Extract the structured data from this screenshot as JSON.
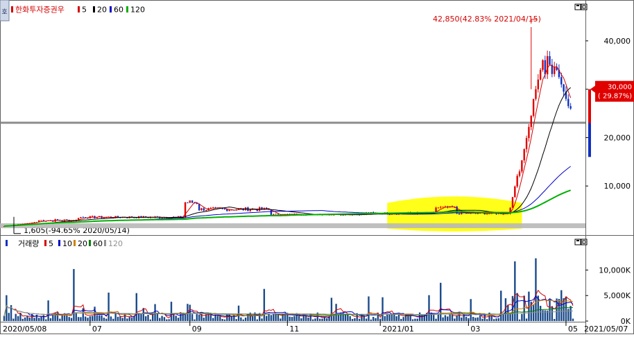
{
  "panel": {
    "side_tab": "호",
    "legend": [
      {
        "text": "한화투자증권우",
        "color": "#d40000"
      },
      {
        "text": "5",
        "color": "#d40000"
      },
      {
        "text": "20",
        "color": "#000000"
      },
      {
        "text": "60",
        "color": "#0000c8"
      },
      {
        "text": "120",
        "color": "#00b000"
      }
    ],
    "annotation_high": "42,850(42.83% 2021/04/15)",
    "annotation_low": "1,605(-94.65% 2020/05/14)",
    "price_box": {
      "line1": "30,000",
      "line2": "( 29.87%)"
    }
  },
  "volume_panel": {
    "legend": [
      {
        "text": "거래량",
        "color": "#000000"
      },
      {
        "text": "5",
        "color": "#d40000"
      },
      {
        "text": "10",
        "color": "#0000c8"
      },
      {
        "text": "20",
        "color": "#d08000"
      },
      {
        "text": "60",
        "color": "#008000"
      },
      {
        "text": "120",
        "color": "#909090"
      }
    ]
  },
  "colors": {
    "up": "#e00000",
    "down": "#1030c0",
    "highlight": "#ffff00",
    "hline": "#808080",
    "box": "#e00000"
  },
  "chart_data": [
    {
      "type": "candlestick",
      "y_axis": {
        "min": 0,
        "max": 45000,
        "ticks": [
          10000,
          20000,
          30000,
          40000
        ],
        "tick_labels": [
          "10,000",
          "20,000",
          "30,000",
          "40,000"
        ]
      },
      "x_axis": {
        "start_label": "2020/05/08",
        "end_label": "2021/05/07",
        "ticks": [
          {
            "label": "07",
            "x_index": 37
          },
          {
            "label": "09",
            "x_index": 80
          },
          {
            "label": "11",
            "x_index": 122
          },
          {
            "label": "2021/01",
            "x_index": 162
          },
          {
            "label": "03",
            "x_index": 200
          },
          {
            "label": "05",
            "x_index": 242
          }
        ]
      },
      "highlights": {
        "horizontal_levels": [
          23000,
          2000
        ],
        "circled_range": [
          165,
          223
        ]
      },
      "annotations": [
        {
          "text": "42,850(42.83% 2021/04/15)",
          "value": 42850
        },
        {
          "text": "1,605(-94.65% 2020/05/14)",
          "value": 1605
        }
      ],
      "last_close": 30000,
      "last_change_pct": 29.87,
      "ma_periods": [
        5,
        20,
        60,
        120
      ]
    },
    {
      "type": "bar",
      "title": "거래량",
      "y_axis": {
        "min": 0,
        "max": 14000,
        "ticks": [
          0,
          5000,
          10000
        ],
        "tick_labels": [
          "0K",
          "5,000K",
          "10,000K"
        ]
      },
      "series_names": [
        "5",
        "10",
        "20",
        "60",
        "120"
      ],
      "notable_volumes_k": [
        {
          "index": 30,
          "value": 10200
        },
        {
          "index": 80,
          "value": 3200
        },
        {
          "index": 112,
          "value": 6300
        },
        {
          "index": 188,
          "value": 7500
        },
        {
          "index": 220,
          "value": 11700
        },
        {
          "index": 229,
          "value": 12300
        },
        {
          "index": 242,
          "value": 4700
        }
      ]
    }
  ]
}
